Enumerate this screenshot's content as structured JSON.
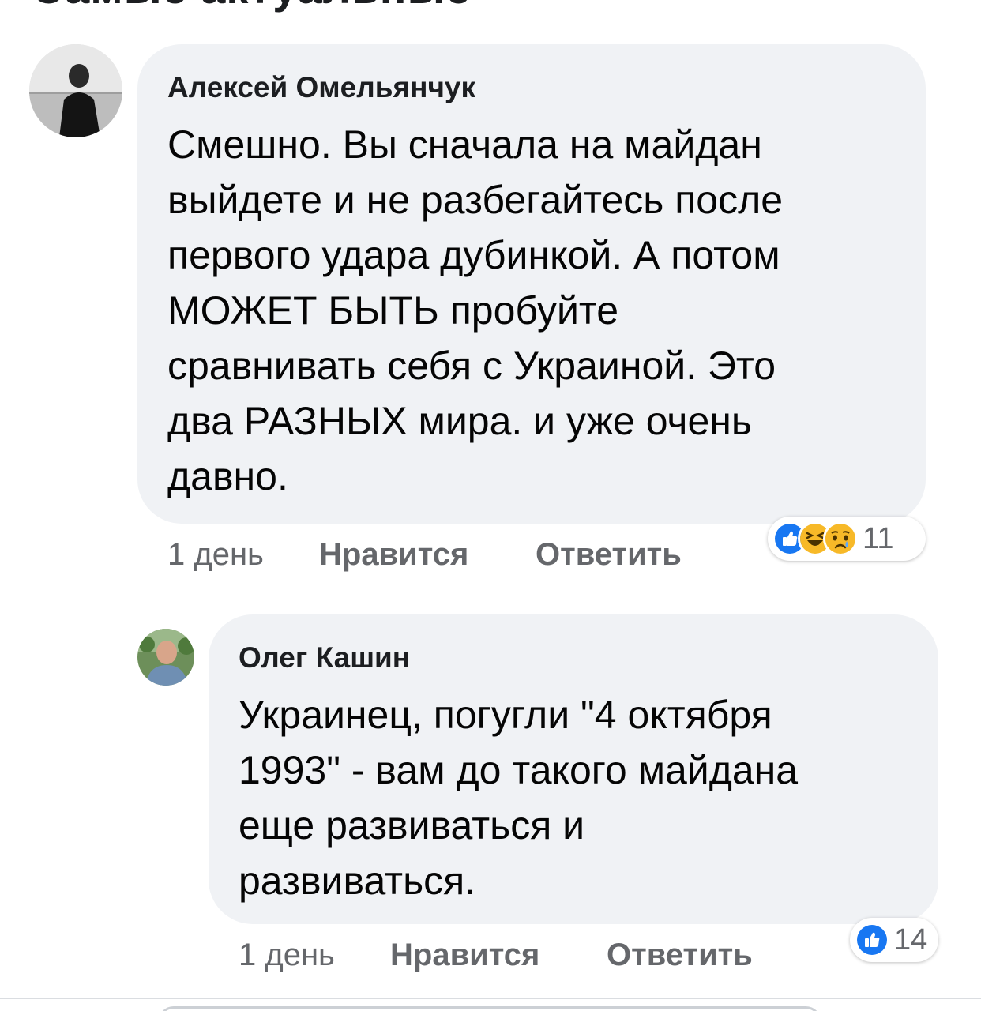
{
  "section": {
    "heading": "Самые актуальные"
  },
  "comments": [
    {
      "author": "Алексей Омельянчук",
      "text": "Смешно. Вы сначала на майдан\nвыйдете и не разбегайтесь после\nпервого удара дубинкой. А потом\nМОЖЕТ БЫТЬ пробуйте\nсравнивать себя с Украиной. Это\nдва РАЗНЫХ мира. и уже очень\nдавно.",
      "time": "1 день",
      "like_label": "Нравится",
      "reply_label": "Ответить",
      "reaction_icons": [
        "like-icon",
        "haha-icon",
        "sad-icon"
      ],
      "reaction_count": "11"
    },
    {
      "author": "Олег Кашин",
      "text": "Украинец, погугли \"4 октября\n1993\" - вам до такого майдана\nеще развиваться и\nразвиваться.",
      "time": "1 день",
      "like_label": "Нравится",
      "reply_label": "Ответить",
      "reaction_icons": [
        "like-icon"
      ],
      "reaction_count": "14"
    }
  ],
  "colors": {
    "bubble": "#f0f2f5",
    "meta_text": "#65676b",
    "like_blue": "#1877f2",
    "emoji_yellow": "#f7b928"
  }
}
